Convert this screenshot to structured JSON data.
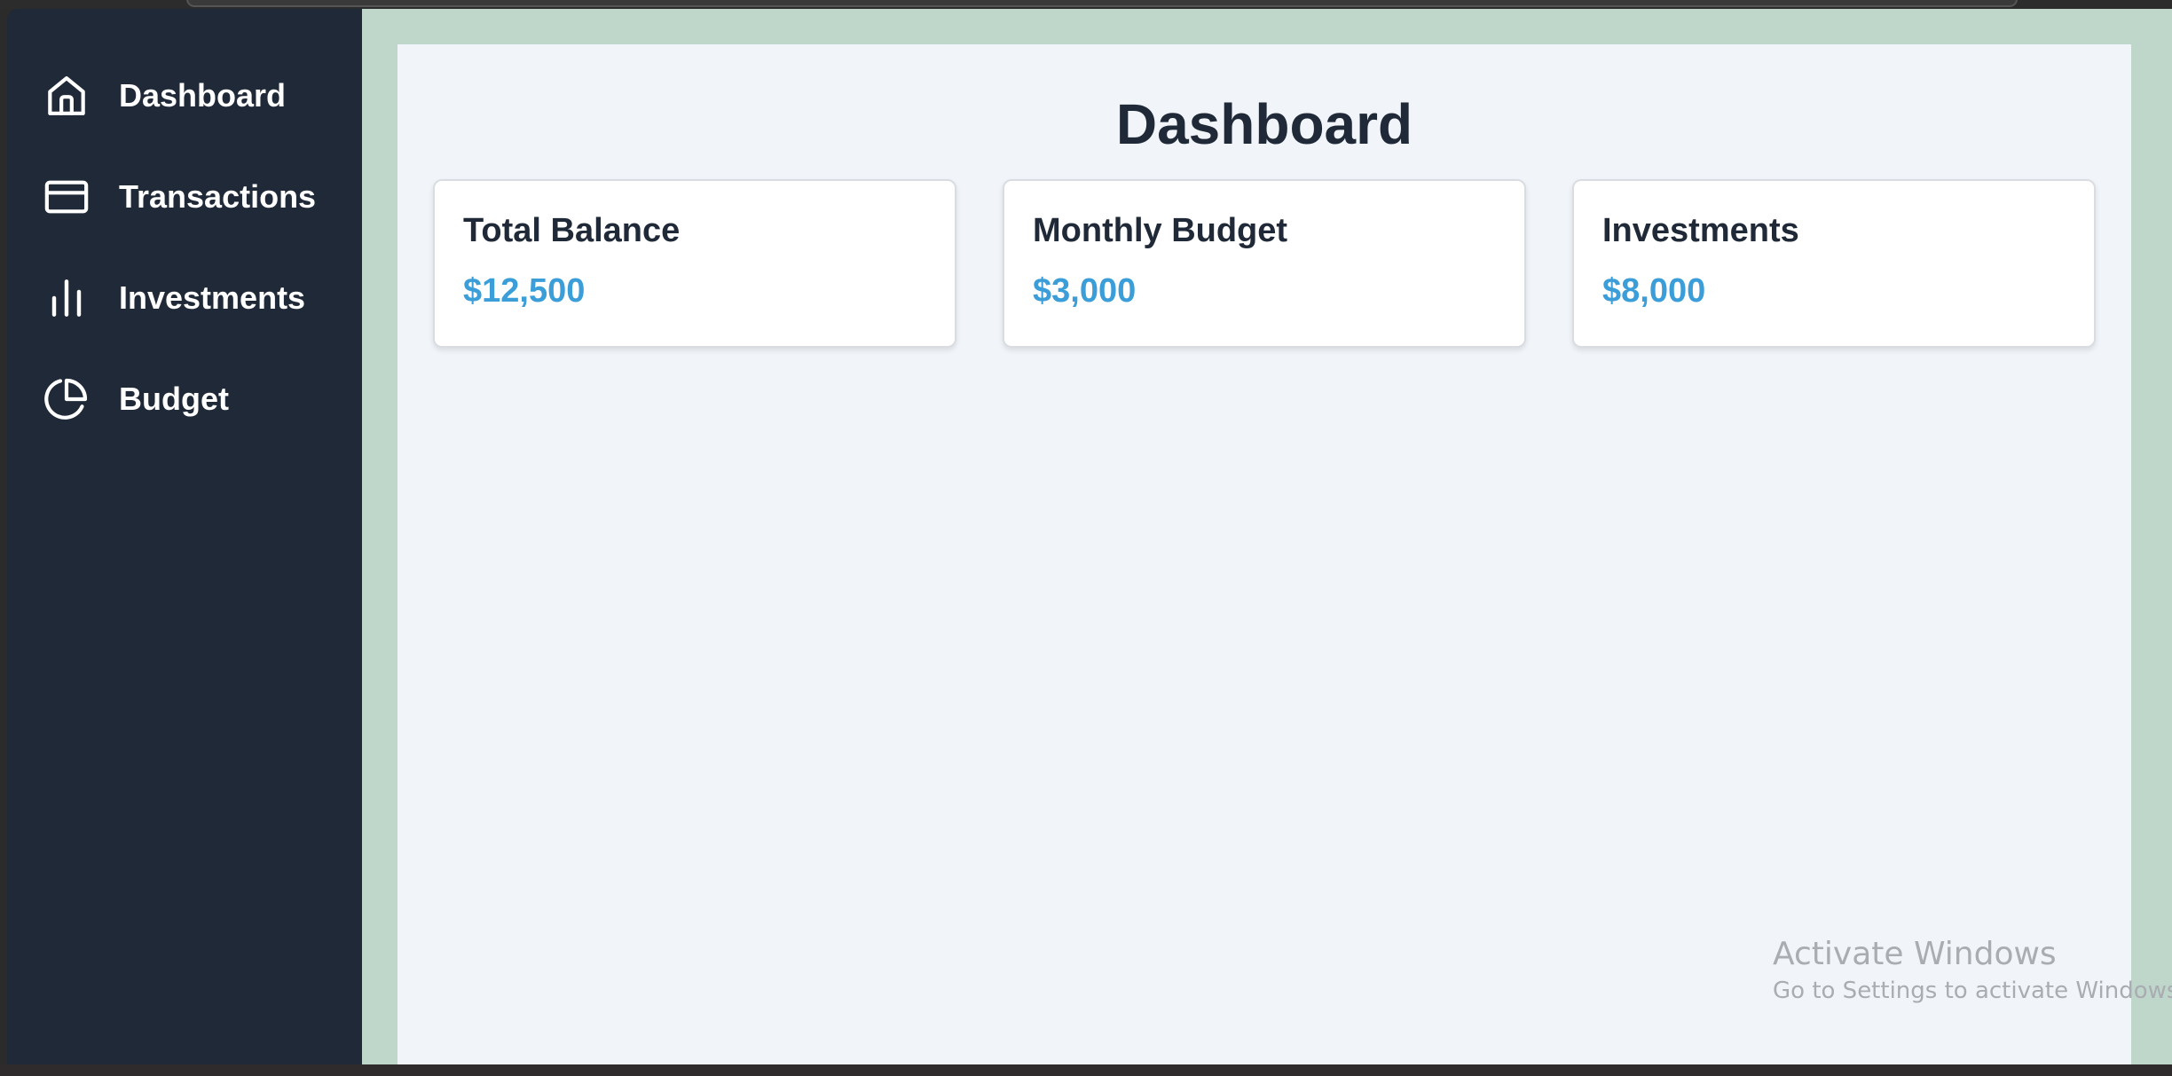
{
  "sidebar": {
    "items": [
      {
        "label": "Dashboard",
        "icon": "home-icon"
      },
      {
        "label": "Transactions",
        "icon": "credit-card-icon"
      },
      {
        "label": "Investments",
        "icon": "bar-chart-icon"
      },
      {
        "label": "Budget",
        "icon": "pie-chart-icon"
      }
    ]
  },
  "main": {
    "title": "Dashboard",
    "cards": [
      {
        "title": "Total Balance",
        "value": "$12,500"
      },
      {
        "title": "Monthly Budget",
        "value": "$3,000"
      },
      {
        "title": "Investments",
        "value": "$8,000"
      }
    ]
  },
  "watermark": {
    "title": "Activate Windows",
    "subtitle": "Go to Settings to activate Windows."
  },
  "colors": {
    "sidebar_bg": "#1f2937",
    "outer_bg": "#bfd6ca",
    "content_bg": "#f1f5f9",
    "accent": "#3b9ed9"
  }
}
